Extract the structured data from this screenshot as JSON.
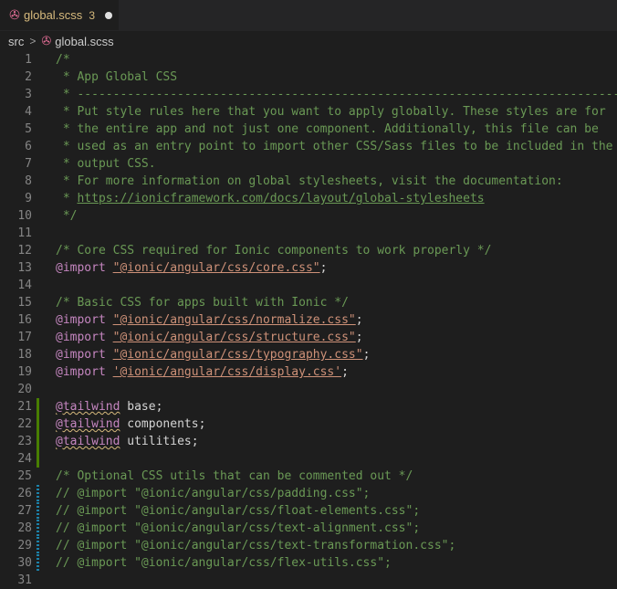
{
  "tab": {
    "filename": "global.scss",
    "problem_count": "3"
  },
  "breadcrumb": {
    "folder": "src",
    "separator": ">",
    "file": "global.scss"
  },
  "lines": [
    {
      "n": "1",
      "t": "/*",
      "k": "c"
    },
    {
      "n": "2",
      "t": " * App Global CSS",
      "k": "c"
    },
    {
      "n": "3",
      "t": " * ----------------------------------------------------------------------------",
      "k": "c"
    },
    {
      "n": "4",
      "t": " * Put style rules here that you want to apply globally. These styles are for",
      "k": "c"
    },
    {
      "n": "5",
      "t": " * the entire app and not just one component. Additionally, this file can be",
      "k": "c"
    },
    {
      "n": "6",
      "t": " * used as an entry point to import other CSS/Sass files to be included in the",
      "k": "c"
    },
    {
      "n": "7",
      "t": " * output CSS.",
      "k": "c"
    },
    {
      "n": "8",
      "t": " * For more information on global stylesheets, visit the documentation:",
      "k": "c"
    },
    {
      "n": "9",
      "t": " * ",
      "u": "https://ionicframework.com/docs/layout/global-stylesheets",
      "k": "c"
    },
    {
      "n": "10",
      "t": " */",
      "k": "c"
    },
    {
      "n": "11",
      "t": "",
      "k": "c"
    },
    {
      "n": "12",
      "t": "/* Core CSS required for Ionic components to work properly */",
      "k": "c"
    },
    {
      "n": "13",
      "kw": "@import",
      "s": "\"@ionic/angular/css/core.css\"",
      "k": "imp"
    },
    {
      "n": "14",
      "t": "",
      "k": "c"
    },
    {
      "n": "15",
      "t": "/* Basic CSS for apps built with Ionic */",
      "k": "c"
    },
    {
      "n": "16",
      "kw": "@import",
      "s": "\"@ionic/angular/css/normalize.css\"",
      "k": "imp"
    },
    {
      "n": "17",
      "kw": "@import",
      "s": "\"@ionic/angular/css/structure.css\"",
      "k": "imp"
    },
    {
      "n": "18",
      "kw": "@import",
      "s": "\"@ionic/angular/css/typography.css\"",
      "k": "imp"
    },
    {
      "n": "19",
      "kw": "@import",
      "s": "'@ionic/angular/css/display.css'",
      "k": "imp"
    },
    {
      "n": "20",
      "t": "",
      "k": "c"
    },
    {
      "n": "21",
      "kw": "@tailwind",
      "s": "base",
      "k": "tw",
      "g": "added"
    },
    {
      "n": "22",
      "kw": "@tailwind",
      "s": "components",
      "k": "tw",
      "g": "added"
    },
    {
      "n": "23",
      "kw": "@tailwind",
      "s": "utilities",
      "k": "tw",
      "g": "added"
    },
    {
      "n": "24",
      "t": "",
      "k": "c",
      "g": "added"
    },
    {
      "n": "25",
      "t": "/* Optional CSS utils that can be commented out */",
      "k": "c"
    },
    {
      "n": "26",
      "t": "// @import \"@ionic/angular/css/padding.css\";",
      "k": "c",
      "g": "modified"
    },
    {
      "n": "27",
      "t": "// @import \"@ionic/angular/css/float-elements.css\";",
      "k": "c",
      "g": "modified"
    },
    {
      "n": "28",
      "t": "// @import \"@ionic/angular/css/text-alignment.css\";",
      "k": "c",
      "g": "modified"
    },
    {
      "n": "29",
      "t": "// @import \"@ionic/angular/css/text-transformation.css\";",
      "k": "c",
      "g": "modified"
    },
    {
      "n": "30",
      "t": "// @import \"@ionic/angular/css/flex-utils.css\";",
      "k": "c",
      "g": "modified"
    },
    {
      "n": "31",
      "t": "",
      "k": "c"
    }
  ],
  "colors": {
    "editor_bg": "#1e1e1e",
    "comment": "#6a9955",
    "keyword": "#c586c0",
    "string": "#ce9178",
    "added_gutter": "#487e02",
    "modified_gutter": "#1b81a8"
  }
}
